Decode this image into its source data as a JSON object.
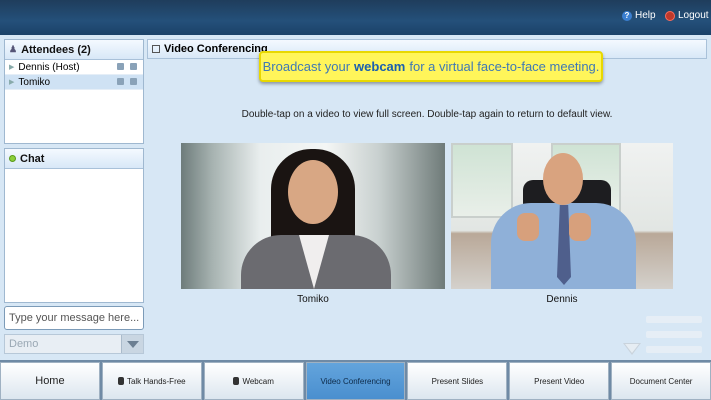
{
  "topbar": {
    "help_label": "Help",
    "logout_label": "Logout"
  },
  "attendees": {
    "title": "Attendees (2)",
    "list": [
      {
        "name": "Dennis  (Host)"
      },
      {
        "name": "Tomiko"
      }
    ]
  },
  "chat": {
    "title": "Chat",
    "input_placeholder": "Type your message here...",
    "recipient_selected": "Demo"
  },
  "main": {
    "title": "Video Conferencing",
    "banner_prefix": "Broadcast your",
    "banner_highlight": "webcam",
    "banner_suffix": "for a virtual face-to-face meeting.",
    "hint": "Double-tap on a video to view full screen. Double-tap again to return to default view.",
    "videos": [
      {
        "label": "Tomiko"
      },
      {
        "label": "Dennis"
      }
    ]
  },
  "bottom_tabs": [
    {
      "label": "Home"
    },
    {
      "label": "Talk Hands-Free"
    },
    {
      "label": "Webcam"
    },
    {
      "label": "Video Conferencing",
      "active": true
    },
    {
      "label": "Present Slides"
    },
    {
      "label": "Present Video"
    },
    {
      "label": "Document Center"
    }
  ],
  "colors": {
    "accent_active_tab": "#4a8fcf",
    "banner_yellow": "#fff55a",
    "banner_text": "#3f78b5"
  }
}
